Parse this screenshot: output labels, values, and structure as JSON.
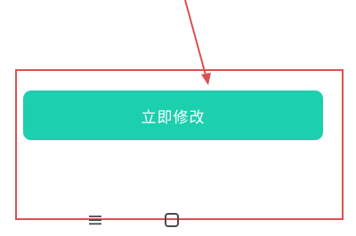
{
  "button": {
    "label": "立即修改"
  },
  "colors": {
    "button_bg": "#1ccfae",
    "button_text": "#ffffff",
    "annotation_red": "#dc4f4f",
    "nav_icon": "#4a4a4a"
  },
  "nav": {
    "menu_icon": "menu-lines-icon",
    "home_icon": "home-square-icon"
  }
}
